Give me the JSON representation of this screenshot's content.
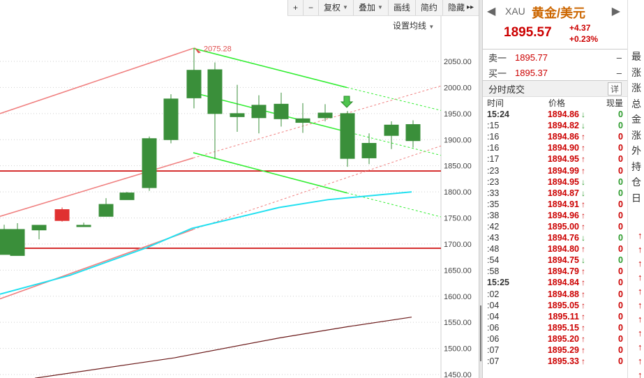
{
  "toolbar": {
    "zoom_in": "+",
    "zoom_out": "−",
    "adjust": "复权",
    "overlay": "叠加",
    "draw_line": "画线",
    "simplify": "简约",
    "hide": "隐藏",
    "hide_arrows": "▸▸"
  },
  "ma_setting": "设置均线",
  "chart_data": {
    "type": "candlestick",
    "y_ticks": [
      "2050.00",
      "2000.00",
      "1950.00",
      "1900.00",
      "1850.00",
      "1800.00",
      "1750.00",
      "1700.00",
      "1650.00",
      "1600.00",
      "1550.00",
      "1500.00",
      "1450.00"
    ],
    "ylim": [
      1443,
      2103
    ],
    "annotation": "2075.28",
    "horizontal_lines": [
      1840,
      1692
    ],
    "candles": [
      {
        "o": 1728,
        "h": 1737,
        "l": 1688,
        "c": 1680,
        "up": false
      },
      {
        "o": 1678,
        "h": 1740,
        "l": 1680,
        "c": 1728,
        "up": true
      },
      {
        "o": 1727,
        "h": 1728,
        "l": 1709,
        "c": 1736,
        "up": true
      },
      {
        "o": 1766,
        "h": 1770,
        "l": 1743,
        "c": 1745,
        "up": false
      },
      {
        "o": 1735,
        "h": 1741,
        "l": 1737,
        "c": 1736,
        "up": true
      },
      {
        "o": 1776,
        "h": 1788,
        "l": 1770,
        "c": 1753,
        "up": true
      },
      {
        "o": 1798,
        "h": 1800,
        "l": 1787,
        "c": 1785,
        "up": true
      },
      {
        "o": 1808,
        "h": 1906,
        "l": 1802,
        "c": 1902,
        "up": true
      },
      {
        "o": 1900,
        "h": 1987,
        "l": 1893,
        "c": 1978,
        "up": true
      },
      {
        "o": 2033,
        "h": 2074,
        "l": 1960,
        "c": 1980,
        "up": true
      },
      {
        "o": 2034,
        "h": 2048,
        "l": 1863,
        "c": 1950,
        "up": true
      },
      {
        "o": 1950,
        "h": 2005,
        "l": 1915,
        "c": 1944,
        "up": true
      },
      {
        "o": 1966,
        "h": 1985,
        "l": 1912,
        "c": 1942,
        "up": true
      },
      {
        "o": 1968,
        "h": 1990,
        "l": 1925,
        "c": 1940,
        "up": true
      },
      {
        "o": 1940,
        "h": 1970,
        "l": 1913,
        "c": 1933,
        "up": true
      },
      {
        "o": 1951,
        "h": 1968,
        "l": 1935,
        "c": 1942,
        "up": true
      },
      {
        "o": 1950,
        "h": 1955,
        "l": 1848,
        "c": 1864,
        "up": false
      },
      {
        "o": 1893,
        "h": 1912,
        "l": 1853,
        "c": 1865,
        "up": false
      },
      {
        "o": 1928,
        "h": 1935,
        "l": 1882,
        "c": 1908,
        "up": true
      },
      {
        "o": 1929,
        "h": 1937,
        "l": 1885,
        "c": 1898,
        "up": true
      }
    ],
    "series": [
      {
        "name": "",
        "points": [
          [
            0,
            1604
          ],
          [
            100,
            1640
          ],
          [
            210,
            1693
          ],
          [
            275,
            1730
          ],
          [
            400,
            1770
          ],
          [
            470,
            1785
          ],
          [
            590,
            1800
          ]
        ]
      },
      {
        "name": "",
        "points": [
          [
            50,
            1443
          ],
          [
            250,
            1482
          ],
          [
            400,
            1520
          ],
          [
            500,
            1542
          ],
          [
            590,
            1560
          ]
        ]
      }
    ]
  },
  "quote": {
    "symbol": "XAU",
    "name": "黄金/美元",
    "price": "1895.57",
    "change": "+4.37",
    "change_pct": "+0.23%",
    "sell_label": "卖一",
    "sell_price": "1895.77",
    "sell_qty": "–",
    "buy_label": "买一",
    "buy_price": "1895.37",
    "buy_qty": "–",
    "ticks_title": "分时成交",
    "detail": "详",
    "col_time": "时间",
    "col_price": "价格",
    "col_volume": "现量",
    "ticks": [
      {
        "t": "15:24",
        "p": "1894.86",
        "dir": "down",
        "v": "0",
        "big": true
      },
      {
        "t": ":15",
        "p": "1894.82",
        "dir": "down",
        "v": "0"
      },
      {
        "t": ":16",
        "p": "1894.86",
        "dir": "up",
        "v": "0"
      },
      {
        "t": ":16",
        "p": "1894.90",
        "dir": "up",
        "v": "0"
      },
      {
        "t": ":17",
        "p": "1894.95",
        "dir": "up",
        "v": "0"
      },
      {
        "t": ":23",
        "p": "1894.99",
        "dir": "up",
        "v": "0"
      },
      {
        "t": ":23",
        "p": "1894.95",
        "dir": "down",
        "v": "0"
      },
      {
        "t": ":33",
        "p": "1894.87",
        "dir": "down",
        "v": "0"
      },
      {
        "t": ":35",
        "p": "1894.91",
        "dir": "up",
        "v": "0"
      },
      {
        "t": ":38",
        "p": "1894.96",
        "dir": "up",
        "v": "0"
      },
      {
        "t": ":42",
        "p": "1895.00",
        "dir": "up",
        "v": "0"
      },
      {
        "t": ":43",
        "p": "1894.76",
        "dir": "down",
        "v": "0"
      },
      {
        "t": ":48",
        "p": "1894.80",
        "dir": "up",
        "v": "0"
      },
      {
        "t": ":54",
        "p": "1894.75",
        "dir": "down",
        "v": "0"
      },
      {
        "t": ":58",
        "p": "1894.79",
        "dir": "up",
        "v": "0"
      },
      {
        "t": "15:25",
        "p": "1894.84",
        "dir": "up",
        "v": "0",
        "big": true
      },
      {
        "t": ":02",
        "p": "1894.88",
        "dir": "up",
        "v": "0"
      },
      {
        "t": ":04",
        "p": "1895.05",
        "dir": "up",
        "v": "0"
      },
      {
        "t": ":04",
        "p": "1895.11",
        "dir": "up",
        "v": "0"
      },
      {
        "t": ":06",
        "p": "1895.15",
        "dir": "up",
        "v": "0"
      },
      {
        "t": ":06",
        "p": "1895.20",
        "dir": "up",
        "v": "0"
      },
      {
        "t": ":07",
        "p": "1895.29",
        "dir": "up",
        "v": "0"
      },
      {
        "t": ":07",
        "p": "1895.33",
        "dir": "up",
        "v": "0"
      }
    ]
  },
  "info": {
    "labels": [
      "最",
      "涨",
      "涨",
      "总",
      "金",
      "涨",
      "外",
      "持",
      "仓",
      "日"
    ],
    "arrows": [
      "↑",
      "↑",
      "↑",
      "↑",
      "↑",
      "↑",
      "↑",
      "↑",
      "↑",
      "↑",
      "↑"
    ]
  },
  "colors": {
    "up": "#e03030",
    "down": "#3a8f3a",
    "trend_red": "#f08080",
    "trend_green": "#33ee33",
    "ma_cyan": "#22e0f0",
    "ma_dark": "#6b1a1a",
    "hline": "#cc0000"
  }
}
